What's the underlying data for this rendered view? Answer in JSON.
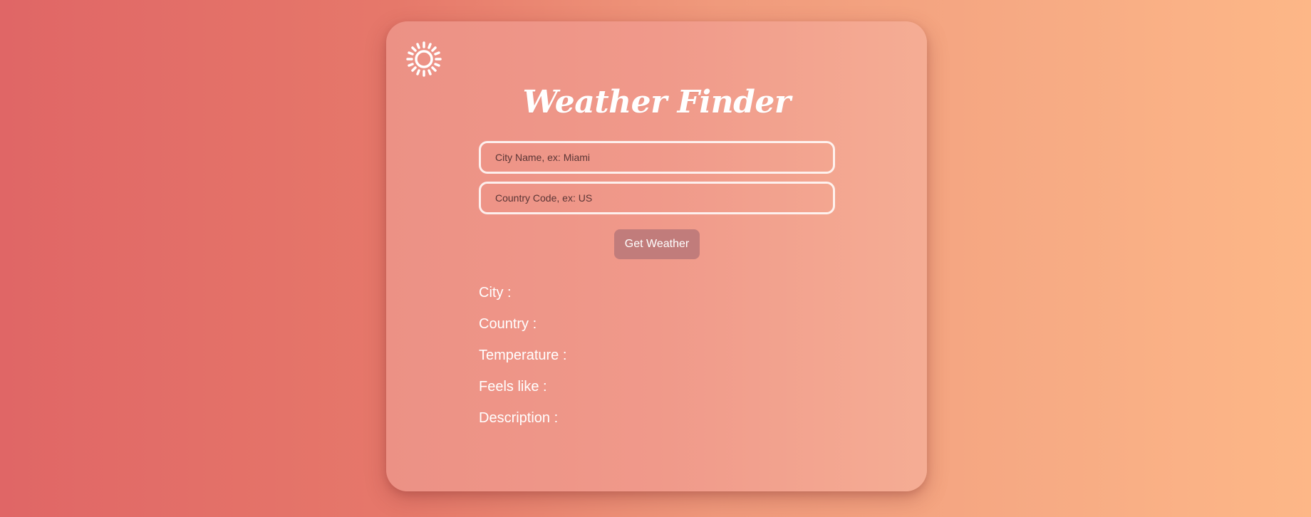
{
  "app": {
    "title": "Weather Finder",
    "icon": "sun-icon"
  },
  "form": {
    "city_placeholder": "City Name, ex: Miami",
    "city_value": "",
    "country_placeholder": "Country Code, ex: US",
    "country_value": "",
    "submit_label": "Get Weather"
  },
  "results": {
    "city_label": "City :",
    "city_value": "",
    "country_label": "Country :",
    "country_value": "",
    "temperature_label": "Temperature :",
    "temperature_value": "",
    "feels_like_label": "Feels like :",
    "feels_like_value": "",
    "description_label": "Description :",
    "description_value": ""
  },
  "colors": {
    "bg_start": "#e06666",
    "bg_end": "#fdb787",
    "card": "#f0998a",
    "button": "#c17c7b",
    "text": "#ffffff"
  }
}
